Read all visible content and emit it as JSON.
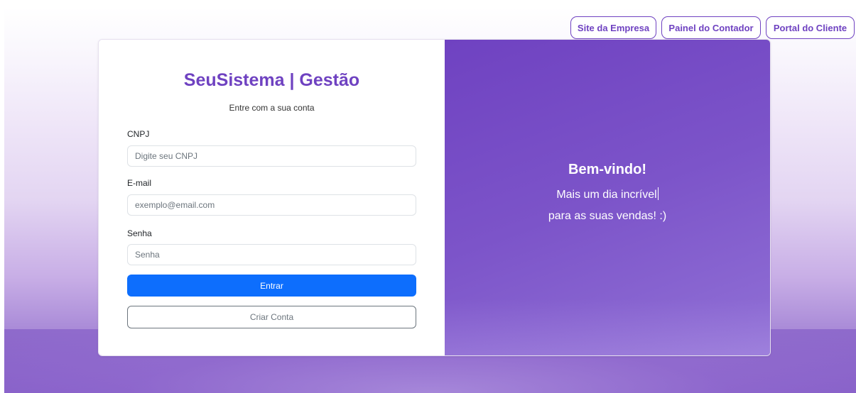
{
  "top_nav": {
    "links": [
      {
        "label": "Site da Empresa"
      },
      {
        "label": "Painel do Contador"
      },
      {
        "label": "Portal do Cliente"
      }
    ]
  },
  "login": {
    "brand": "SeuSistema | Gestão",
    "subtitle": "Entre com a sua conta",
    "cnpj": {
      "label": "CNPJ",
      "placeholder": "Digite seu CNPJ",
      "value": ""
    },
    "email": {
      "label": "E-mail",
      "placeholder": "exemplo@email.com",
      "value": ""
    },
    "password": {
      "label": "Senha",
      "placeholder": "Senha",
      "value": ""
    },
    "submit_label": "Entrar",
    "create_account_label": "Criar Conta"
  },
  "welcome": {
    "title": "Bem-vindo!",
    "line1": "Mais um dia incrível",
    "line2": "para as suas vendas! :)"
  },
  "colors": {
    "brand_purple": "#6f42c1",
    "primary_blue": "#0d6efd",
    "outline_gray": "#6c757d"
  }
}
